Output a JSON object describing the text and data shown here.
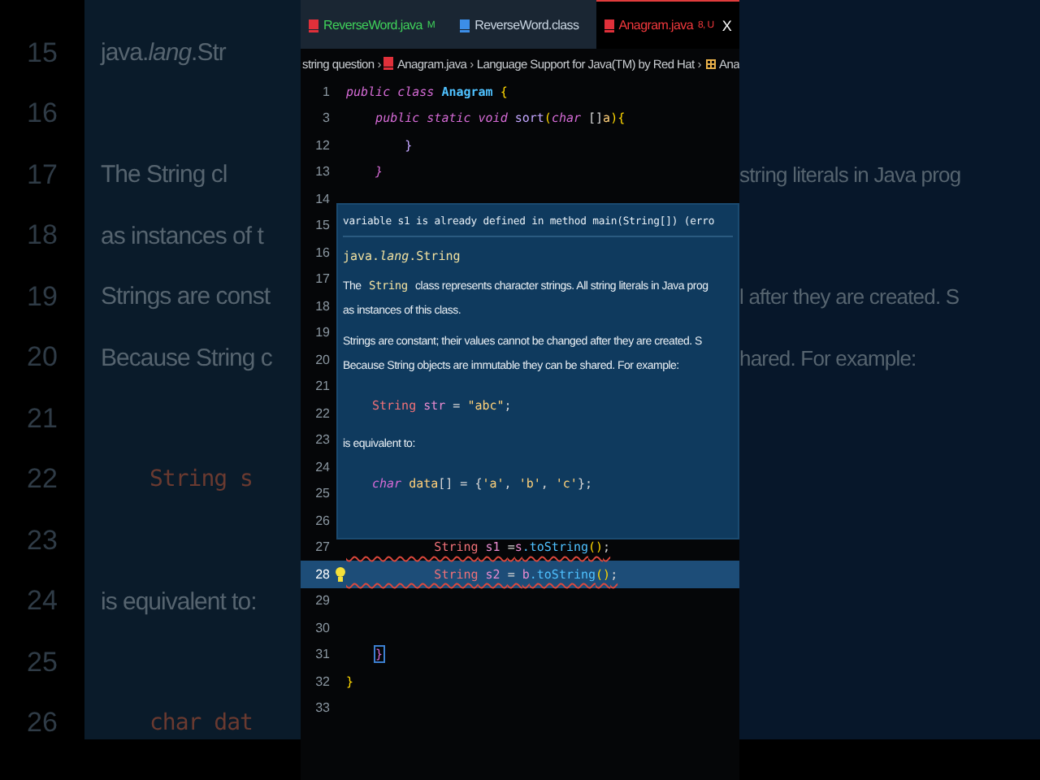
{
  "tabs": [
    {
      "label": "ReverseWord.java",
      "status": "M",
      "color": "#3fd15a",
      "kind": "java",
      "selected": false
    },
    {
      "label": "ReverseWord.class",
      "color": "#c8d4e0",
      "kind": "class",
      "selected": false
    },
    {
      "label": "Anagram.java",
      "status": "8, U",
      "color": "#f0383c",
      "kind": "java",
      "selected": true,
      "close": "X"
    }
  ],
  "breadcrumb": [
    {
      "label": "string question",
      "kind": "folder"
    },
    {
      "sep": "›",
      "label": "Anagram.java",
      "kind": "java"
    },
    {
      "sep": "›",
      "label": "Language Support for Java(TM) by Red Hat",
      "kind": "plain"
    },
    {
      "sep": "›",
      "label": "Ana",
      "kind": "class"
    }
  ],
  "backdrop": [
    {
      "number": "15",
      "left": "java.*lang*.Str"
    },
    {
      "number": "16"
    },
    {
      "number": "17",
      "left": "The String cl",
      "right": "string literals in Java prog"
    },
    {
      "number": "18",
      "left": "as instances of t"
    },
    {
      "number": "19",
      "left": "Strings are const",
      "right": "l after they are created. S"
    },
    {
      "number": "20",
      "left": "Because String c",
      "right": "hared. For example:"
    },
    {
      "number": "21"
    },
    {
      "number": "22",
      "left": "String s",
      "kind": "code"
    },
    {
      "number": "23"
    },
    {
      "number": "24",
      "left": "is equivalent to:"
    },
    {
      "number": "25"
    },
    {
      "number": "26",
      "left": "char dat",
      "kind": "code"
    }
  ],
  "lines": [
    {
      "number": "1",
      "tokens": [
        {
          "t": "public class ",
          "kind": "kw"
        },
        {
          "t": "Anagram",
          "kind": "cls"
        },
        {
          "t": " {",
          "kind": "brace"
        }
      ]
    },
    {
      "number": "3",
      "tokens": [
        {
          "t": "    public static void ",
          "kind": "kw"
        },
        {
          "t": "sort",
          "kind": "fn"
        },
        {
          "t": "(",
          "kind": "brace"
        },
        {
          "t": "char",
          "kind": "kw"
        },
        {
          "t": " []",
          "kind": "plain"
        },
        {
          "t": "a",
          "kind": "param"
        },
        {
          "t": "){",
          "kind": "brace"
        }
      ]
    },
    {
      "number": "12",
      "tokens": [
        {
          "t": "        }",
          "kind": "fn"
        }
      ]
    },
    {
      "number": "13",
      "tokens": [
        {
          "t": "    }",
          "kind": "kw"
        }
      ]
    },
    {
      "number": "14"
    },
    {
      "number": "15"
    },
    {
      "number": "16"
    },
    {
      "number": "17"
    },
    {
      "number": "18"
    },
    {
      "number": "19"
    },
    {
      "number": "20"
    },
    {
      "number": "21"
    },
    {
      "number": "22"
    },
    {
      "number": "23"
    },
    {
      "number": "24"
    },
    {
      "number": "25"
    },
    {
      "number": "26"
    },
    {
      "number": "27",
      "error": true,
      "tokens": [
        {
          "t": "            String",
          "kind": "type"
        },
        {
          "t": " s1 ",
          "kind": "var"
        },
        {
          "t": "=",
          "kind": "plain"
        },
        {
          "t": "s",
          "kind": "var"
        },
        {
          "t": ".toString",
          "kind": "call"
        },
        {
          "t": "()",
          "kind": "brace"
        },
        {
          "t": ";",
          "kind": "plain"
        }
      ]
    },
    {
      "number": "28",
      "error": true,
      "selected": true,
      "lightbulb": true,
      "tokens": [
        {
          "t": "            String",
          "kind": "type"
        },
        {
          "t": " s2 ",
          "kind": "var"
        },
        {
          "t": "= ",
          "kind": "plain"
        },
        {
          "t": "b",
          "kind": "var"
        },
        {
          "t": ".toString",
          "kind": "call"
        },
        {
          "t": "()",
          "kind": "brace"
        },
        {
          "t": ";",
          "kind": "plain"
        }
      ]
    },
    {
      "number": "29"
    },
    {
      "number": "30"
    },
    {
      "number": "31",
      "tokens": [
        {
          "t": "}",
          "kind": "match"
        }
      ]
    },
    {
      "number": "32",
      "tokens": [
        {
          "t": "}",
          "kind": "brace"
        }
      ]
    },
    {
      "number": "33"
    }
  ],
  "hover": {
    "error": "variable s1 is already defined in method main(String[]) (erro",
    "signature": "java.*lang*.String",
    "blocks": [
      {
        "kind": "para",
        "segments": [
          {
            "t": "The ",
            "kind": "text"
          },
          {
            "t": "String",
            "kind": "code"
          },
          {
            "t": " class represents character strings. All string literals in Java prog",
            "kind": "text"
          }
        ],
        "cont": "as instances of this class."
      },
      {
        "kind": "para",
        "segments": [
          {
            "t": "Strings are constant; their values cannot be changed after they are created. S",
            "kind": "text"
          }
        ],
        "cont": "Because String objects are immutable they can be shared. For example:"
      },
      {
        "kind": "code",
        "tokens": [
          {
            "t": "String",
            "kind": "type"
          },
          {
            "t": " str ",
            "kind": "var"
          },
          {
            "t": "= ",
            "kind": "plain"
          },
          {
            "t": "\"abc\"",
            "kind": "str"
          },
          {
            "t": ";",
            "kind": "plain"
          }
        ]
      },
      {
        "kind": "para",
        "segments": [
          {
            "t": "is equivalent to:",
            "kind": "text"
          }
        ]
      },
      {
        "kind": "code",
        "tokens": [
          {
            "t": "char",
            "kind": "kw"
          },
          {
            "t": " data",
            "kind": "param"
          },
          {
            "t": "[] = {",
            "kind": "plain"
          },
          {
            "t": "'a'",
            "kind": "str"
          },
          {
            "t": ", ",
            "kind": "plain"
          },
          {
            "t": "'b'",
            "kind": "str"
          },
          {
            "t": ", ",
            "kind": "plain"
          },
          {
            "t": "'c'",
            "kind": "str"
          },
          {
            "t": "};",
            "kind": "plain"
          }
        ]
      }
    ]
  }
}
